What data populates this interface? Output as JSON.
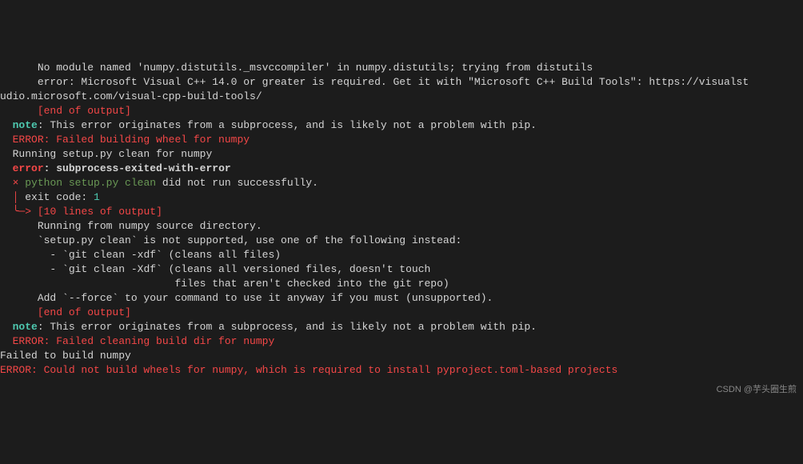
{
  "terminal": {
    "lines": [
      {
        "indent": "      ",
        "segments": [
          {
            "cls": "white",
            "t": "No module named 'numpy.distutils._msvccompiler' in numpy.distutils; trying from distutils"
          }
        ]
      },
      {
        "indent": "      ",
        "segments": [
          {
            "cls": "white",
            "t": "error: Microsoft Visual C++ 14.0 or greater is required. Get it with \"Microsoft C++ Build Tools\": https://visualst"
          }
        ]
      },
      {
        "indent": "",
        "segments": [
          {
            "cls": "white",
            "t": "udio.microsoft.com/visual-cpp-build-tools/"
          }
        ]
      },
      {
        "indent": "      ",
        "segments": [
          {
            "cls": "red",
            "t": "[end of output]"
          }
        ]
      },
      {
        "indent": "",
        "segments": [
          {
            "cls": "white",
            "t": ""
          }
        ]
      },
      {
        "indent": "  ",
        "segments": [
          {
            "cls": "cyan bold",
            "t": "note"
          },
          {
            "cls": "white",
            "t": ": This error originates from a subprocess, and is likely not a problem with pip."
          }
        ]
      },
      {
        "indent": "  ",
        "segments": [
          {
            "cls": "red",
            "t": "ERROR: Failed building wheel for numpy"
          }
        ]
      },
      {
        "indent": "  ",
        "segments": [
          {
            "cls": "white",
            "t": "Running setup.py clean for numpy"
          }
        ]
      },
      {
        "indent": "  ",
        "segments": [
          {
            "cls": "red bold",
            "t": "error"
          },
          {
            "cls": "white bold",
            "t": ": "
          },
          {
            "cls": "white bold",
            "t": "subprocess-exited-with-error"
          }
        ]
      },
      {
        "indent": "",
        "segments": [
          {
            "cls": "white",
            "t": ""
          }
        ]
      },
      {
        "indent": "  ",
        "segments": [
          {
            "cls": "red",
            "t": "×"
          },
          {
            "cls": "white",
            "t": " "
          },
          {
            "cls": "green",
            "t": "python setup.py clean"
          },
          {
            "cls": "white",
            "t": " did not run successfully."
          }
        ]
      },
      {
        "indent": "  ",
        "segments": [
          {
            "cls": "red",
            "t": "│"
          },
          {
            "cls": "white",
            "t": " exit code: "
          },
          {
            "cls": "cyan",
            "t": "1"
          }
        ]
      },
      {
        "indent": "  ",
        "segments": [
          {
            "cls": "red",
            "t": "╰─>"
          },
          {
            "cls": "white",
            "t": " "
          },
          {
            "cls": "red",
            "t": "[10 lines of output]"
          }
        ]
      },
      {
        "indent": "      ",
        "segments": [
          {
            "cls": "white",
            "t": "Running from numpy source directory."
          }
        ]
      },
      {
        "indent": "",
        "segments": [
          {
            "cls": "white",
            "t": ""
          }
        ]
      },
      {
        "indent": "      ",
        "segments": [
          {
            "cls": "white",
            "t": "`setup.py clean` is not supported, use one of the following instead:"
          }
        ]
      },
      {
        "indent": "",
        "segments": [
          {
            "cls": "white",
            "t": ""
          }
        ]
      },
      {
        "indent": "        ",
        "segments": [
          {
            "cls": "white",
            "t": "- `git clean -xdf` (cleans all files)"
          }
        ]
      },
      {
        "indent": "        ",
        "segments": [
          {
            "cls": "white",
            "t": "- `git clean -Xdf` (cleans all versioned files, doesn't touch"
          }
        ]
      },
      {
        "indent": "                            ",
        "segments": [
          {
            "cls": "white",
            "t": "files that aren't checked into the git repo)"
          }
        ]
      },
      {
        "indent": "",
        "segments": [
          {
            "cls": "white",
            "t": ""
          }
        ]
      },
      {
        "indent": "      ",
        "segments": [
          {
            "cls": "white",
            "t": "Add `--force` to your command to use it anyway if you must (unsupported)."
          }
        ]
      },
      {
        "indent": "",
        "segments": [
          {
            "cls": "white",
            "t": ""
          }
        ]
      },
      {
        "indent": "      ",
        "segments": [
          {
            "cls": "red",
            "t": "[end of output]"
          }
        ]
      },
      {
        "indent": "",
        "segments": [
          {
            "cls": "white",
            "t": ""
          }
        ]
      },
      {
        "indent": "  ",
        "segments": [
          {
            "cls": "cyan bold",
            "t": "note"
          },
          {
            "cls": "white",
            "t": ": This error originates from a subprocess, and is likely not a problem with pip."
          }
        ]
      },
      {
        "indent": "  ",
        "segments": [
          {
            "cls": "red",
            "t": "ERROR: Failed cleaning build dir for numpy"
          }
        ]
      },
      {
        "indent": "",
        "segments": [
          {
            "cls": "white",
            "t": "Failed to build numpy"
          }
        ]
      },
      {
        "indent": "",
        "segments": [
          {
            "cls": "red",
            "t": "ERROR: Could not build wheels for numpy, which is required to install pyproject.toml-based projects"
          }
        ]
      }
    ]
  },
  "watermark": "CSDN @芋头圈生煎"
}
